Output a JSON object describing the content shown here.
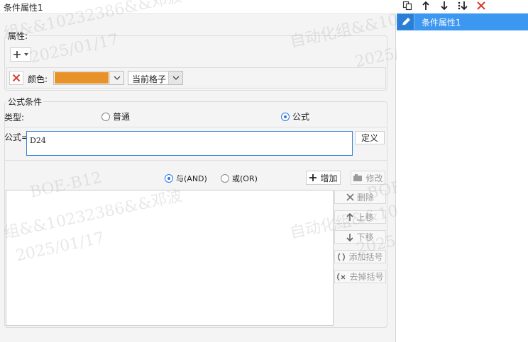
{
  "header": {
    "title": "条件属性1"
  },
  "attributes": {
    "label": "属性:",
    "color_label": "颜色:",
    "scope_value": "当前格子",
    "color_value": "#e8922a"
  },
  "formula_condition": {
    "label": "公式条件",
    "type_label": "类型:",
    "option_normal": "普通",
    "option_formula": "公式",
    "formula_label": "公式=",
    "formula_value": "D24",
    "define_button": "定义"
  },
  "logic": {
    "and_label": "与(AND)",
    "or_label": "或(OR)",
    "add_button": "增加",
    "modify_button": "修改",
    "delete_button": "删除",
    "move_up_button": "上移",
    "move_down_button": "下移",
    "add_bracket_button": "添加括号",
    "remove_bracket_button": "去掉括号"
  },
  "right_panel": {
    "items": [
      {
        "label": "条件属性1"
      }
    ]
  },
  "watermarks": {
    "line1": "自动化组&&10232386&&邓波",
    "line2": "2025/01/17",
    "line3": "BOE-B12",
    "line4": "组&&10232386&&邓波"
  }
}
